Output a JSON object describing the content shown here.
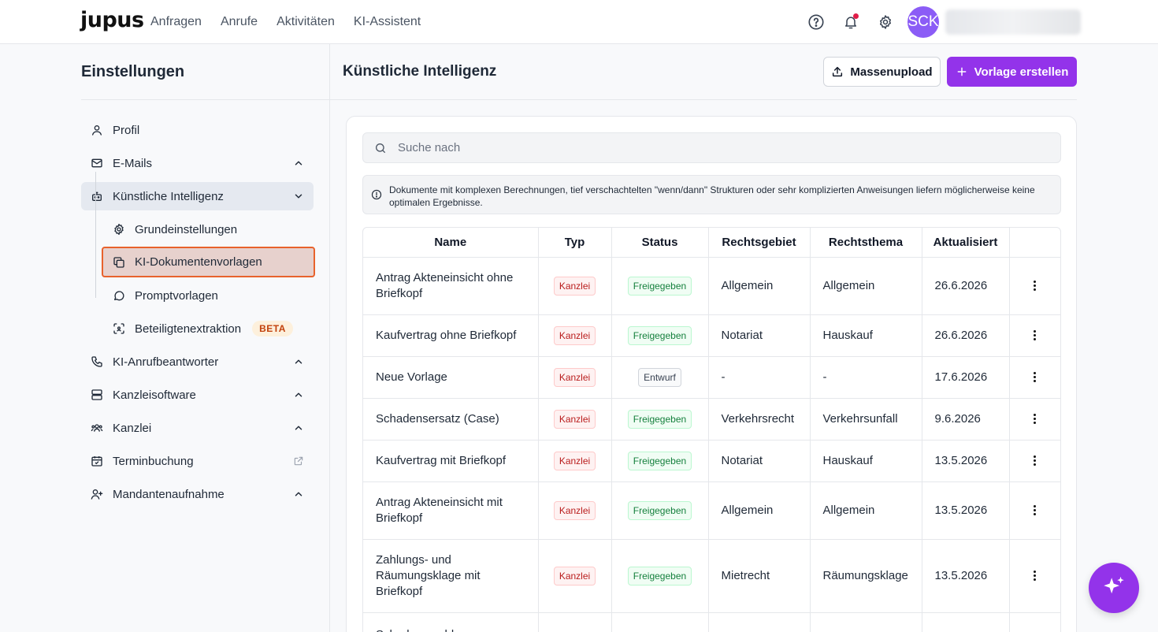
{
  "app": {
    "logo": "jupus"
  },
  "nav": {
    "items": [
      "Anfragen",
      "Anrufe",
      "Aktivitäten",
      "KI-Assistent"
    ]
  },
  "user": {
    "initials": "SCK"
  },
  "sidebar": {
    "title": "Einstellungen",
    "items": {
      "profil": "Profil",
      "emails": "E-Mails",
      "ki": "Künstliche Intelligenz",
      "grund": "Grundeinstellungen",
      "vorlagen": "KI-Dokumentenvorlagen",
      "prompt": "Promptvorlagen",
      "beteiligte": "Beteiligtenextraktion",
      "beta": "BETA",
      "anruf": "KI-Anrufbeantworter",
      "software": "Kanzleisoftware",
      "kanzlei": "Kanzlei",
      "termin": "Terminbuchung",
      "mandanten": "Mandantenaufnahme"
    }
  },
  "main": {
    "title": "Künstliche Intelligenz",
    "upload_label": "Massenupload",
    "create_label": "Vorlage erstellen",
    "search_placeholder": "Suche nach",
    "notice": "Dokumente mit komplexen Berechnungen, tief verschachtelten \"wenn/dann\" Strukturen oder sehr komplizierten Anweisungen liefern möglicherweise keine optimalen Ergebnisse."
  },
  "table": {
    "headers": [
      "Name",
      "Typ",
      "Status",
      "Rechtsgebiet",
      "Rechtsthema",
      "Aktualisiert"
    ],
    "rows": [
      {
        "name": "Antrag Akteneinsicht ohne Briefkopf",
        "typ": "Kanzlei",
        "status": "Freigegeben",
        "gebiet": "Allgemein",
        "thema": "Allgemein",
        "datum": "26.6.2026"
      },
      {
        "name": "Kaufvertrag ohne Briefkopf",
        "typ": "Kanzlei",
        "status": "Freigegeben",
        "gebiet": "Notariat",
        "thema": "Hauskauf",
        "datum": "26.6.2026"
      },
      {
        "name": "Neue Vorlage",
        "typ": "Kanzlei",
        "status": "Entwurf",
        "gebiet": "-",
        "thema": "-",
        "datum": "17.6.2026"
      },
      {
        "name": "Schadensersatz (Case)",
        "typ": "Kanzlei",
        "status": "Freigegeben",
        "gebiet": "Verkehrsrecht",
        "thema": "Verkehrsunfall",
        "datum": "9.6.2026"
      },
      {
        "name": "Kaufvertrag mit Briefkopf",
        "typ": "Kanzlei",
        "status": "Freigegeben",
        "gebiet": "Notariat",
        "thema": "Hauskauf",
        "datum": "13.5.2026"
      },
      {
        "name": "Antrag Akteneinsicht mit Briefkopf",
        "typ": "Kanzlei",
        "status": "Freigegeben",
        "gebiet": "Allgemein",
        "thema": "Allgemein",
        "datum": "13.5.2026"
      },
      {
        "name": "Zahlungs- und Räumungsklage mit Briefkopf",
        "typ": "Kanzlei",
        "status": "Freigegeben",
        "gebiet": "Mietrecht",
        "thema": "Räumungsklage",
        "datum": "13.5.2026"
      },
      {
        "name": "Schadensmeldung",
        "typ": "",
        "status": "",
        "gebiet": "",
        "thema": "",
        "datum": ""
      }
    ]
  },
  "colors": {
    "accent": "#9333ea",
    "selection_border": "#e8622c",
    "avatar": "#8b5cf6"
  }
}
